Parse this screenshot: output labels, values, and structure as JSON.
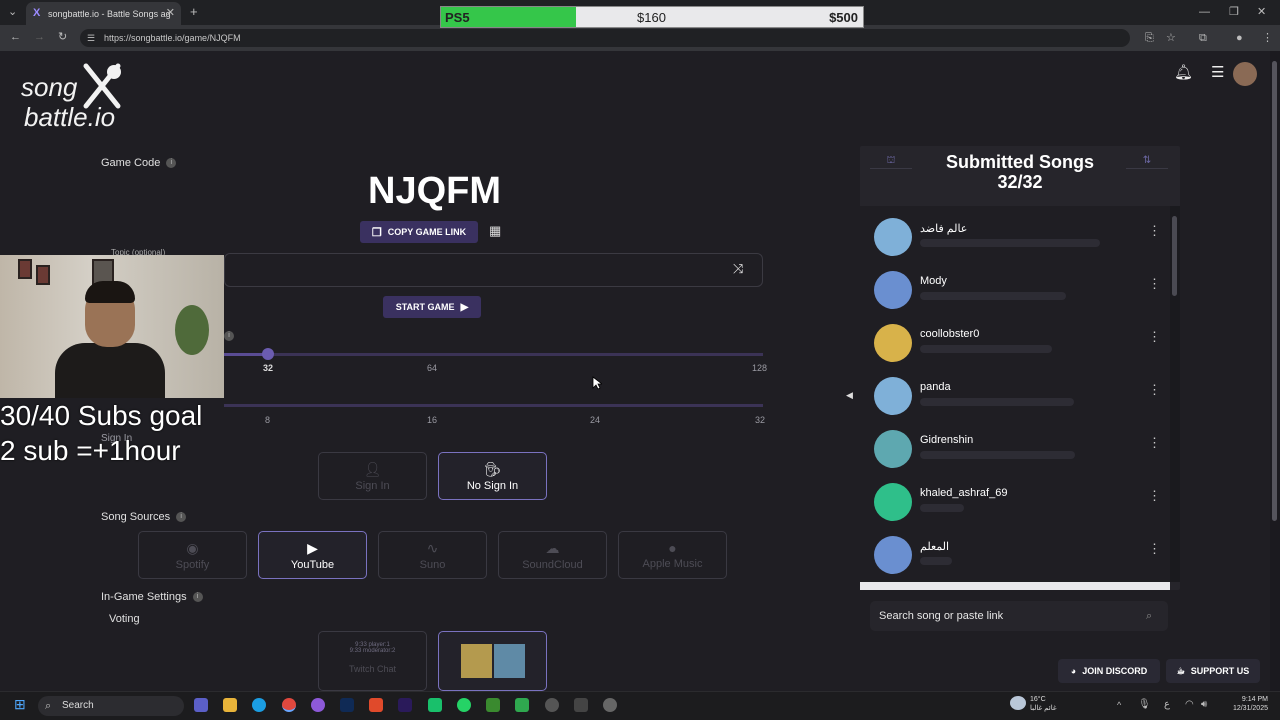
{
  "browser": {
    "tab_title": "songbattle.io - Battle Songs ag",
    "tab_close": "✕",
    "new_tab": "+",
    "url": "https://songbattle.io/game/NJQFM"
  },
  "donation": {
    "label": "PS5",
    "current": "$160",
    "goal": "$500",
    "progress": 0.32
  },
  "logo": {
    "line1": "song",
    "line2": "battle.io"
  },
  "game": {
    "code_label": "Game Code",
    "code": "NJQFM",
    "copy_link_label": "COPY GAME LINK",
    "topic_label": "Topic (optional)",
    "start_label": "START GAME",
    "slider1_ticks": [
      "32",
      "64",
      "128"
    ],
    "slider1_value": 32,
    "slider2_ticks": [
      "8",
      "16",
      "24",
      "32"
    ],
    "sign_in_label": "Sign In",
    "sign_in_options": [
      "Sign In",
      "No Sign In"
    ],
    "song_sources_label": "Song Sources",
    "sources": [
      "Spotify",
      "YouTube",
      "Suno",
      "SoundCloud",
      "Apple Music"
    ],
    "in_game_settings_label": "In-Game Settings",
    "voting_label": "Voting",
    "voting_option": "Twitch Chat",
    "chat_lines": [
      "9:33 player:1",
      "9:33 moderator:2"
    ]
  },
  "overlay": {
    "subs_line1": "30/40 Subs goal",
    "subs_line2": "2 sub =+1hour"
  },
  "panel": {
    "title": "Submitted Songs",
    "count": "32/32",
    "songs": [
      {
        "name": "عالم فاضد",
        "color": "#7fb0d8",
        "bar": 180
      },
      {
        "name": "Mody",
        "color": "#6a8fd0",
        "bar": 146
      },
      {
        "name": "coollobster0",
        "color": "#d8b24a",
        "bar": 132
      },
      {
        "name": "panda",
        "color": "#7fb0d8",
        "bar": 154
      },
      {
        "name": "Gidrenshin",
        "color": "#5ea8b0",
        "bar": 155
      },
      {
        "name": "khaled_ashraf_69",
        "color": "#2fbf8a",
        "bar": 44
      },
      {
        "name": "المعلم",
        "color": "#6a8fd0",
        "bar": 32
      }
    ],
    "search_placeholder": "Search song or paste link"
  },
  "footer": {
    "discord": "JOIN DISCORD",
    "support": "SUPPORT US"
  },
  "taskbar": {
    "search": "Search",
    "weather_temp": "16°C",
    "weather_desc": "غائم غالبا",
    "time": "9:14 PM",
    "date": "12/31/2025",
    "lang": "ع"
  }
}
